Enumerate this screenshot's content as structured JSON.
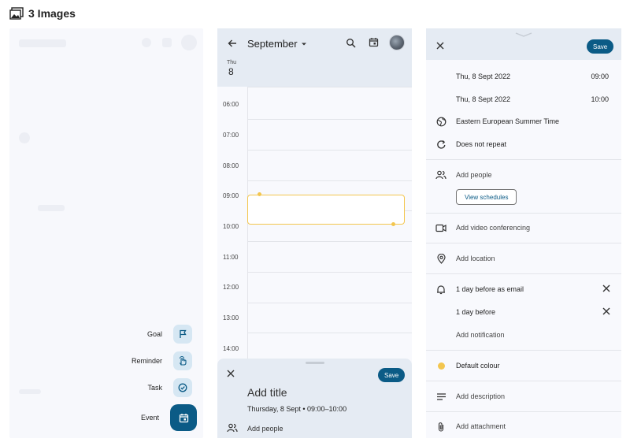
{
  "header": {
    "title": "3 Images"
  },
  "panel1": {
    "menu": [
      {
        "label": "Goal",
        "icon": "flag-icon"
      },
      {
        "label": "Reminder",
        "icon": "reminder-hand-icon"
      },
      {
        "label": "Task",
        "icon": "check-circle-icon"
      }
    ],
    "event_label": "Event"
  },
  "panel2": {
    "month": "September",
    "day_of_week": "Thu",
    "day_of_month": "8",
    "times": [
      "06:00",
      "07:00",
      "08:00",
      "09:00",
      "10:00",
      "11:00",
      "12:00",
      "13:00",
      "14:00"
    ],
    "sheet": {
      "save_label": "Save",
      "title_placeholder": "Add title",
      "date_time": "Thursday, 8 Sept  •  09:00–10:00",
      "add_people": "Add people"
    }
  },
  "panel3": {
    "save_label": "Save",
    "start_date": "Thu, 8 Sept 2022",
    "start_time": "09:00",
    "end_date": "Thu, 8 Sept 2022",
    "end_time": "10:00",
    "timezone": "Eastern European Summer Time",
    "repeat": "Does not repeat",
    "add_people": "Add people",
    "view_schedules": "View schedules",
    "video": "Add video conferencing",
    "location": "Add location",
    "notification_1": "1 day before as email",
    "notification_2": "1 day before",
    "add_notification": "Add notification",
    "colour": "Default colour",
    "description": "Add description",
    "attachment": "Add attachment"
  },
  "colors": {
    "accent": "#0b5b86",
    "event": "#f3c64f",
    "sheet": "#e5ebf3"
  }
}
